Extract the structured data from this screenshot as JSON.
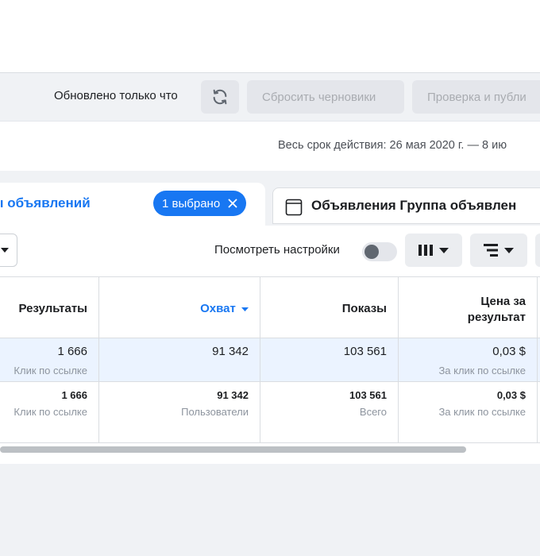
{
  "toolbar": {
    "updated_text": "Обновлено только что",
    "reset_drafts_label": "Сбросить черновики",
    "review_publish_label": "Проверка и публи"
  },
  "date_range": {
    "text": "Весь срок действия: 26 мая 2020 г. — 8 ию"
  },
  "tabs": {
    "active_label": "ы объявлений",
    "selected_pill": "1 выбрано",
    "inactive_label": "Объявления Группа объявлен"
  },
  "panel": {
    "view_settings_label": "Посмотреть настройки"
  },
  "table": {
    "headers": {
      "results": "Результаты",
      "reach": "Охват",
      "impressions": "Показы",
      "cost_per_result_line1": "Цена за",
      "cost_per_result_line2": "результат"
    },
    "row1": {
      "results_value": "1 666",
      "results_sub": "Клик по ссылке",
      "reach_value": "91 342",
      "impressions_value": "103 561",
      "cost_value": "0,03 $",
      "cost_sub": "За клик по ссылке"
    },
    "row2": {
      "results_value": "1 666",
      "results_sub": "Клик по ссылке",
      "reach_value": "91 342",
      "reach_sub": "Пользователи",
      "impressions_value": "103 561",
      "impressions_sub": "Всего",
      "cost_value": "0,03 $",
      "cost_sub": "За клик по ссылке"
    }
  },
  "colors": {
    "accent": "#1877f2",
    "selected_row": "#ebf3ff",
    "disabled_text": "#a9acb1"
  },
  "icons": {
    "refresh": "refresh-icon",
    "pill_close": "close-icon",
    "ads_tab": "ad-window-icon",
    "dropdown": "caret-down-icon",
    "columns": "columns-icon",
    "breakdown": "breakdown-icon",
    "sort": "sort-caret-icon"
  }
}
